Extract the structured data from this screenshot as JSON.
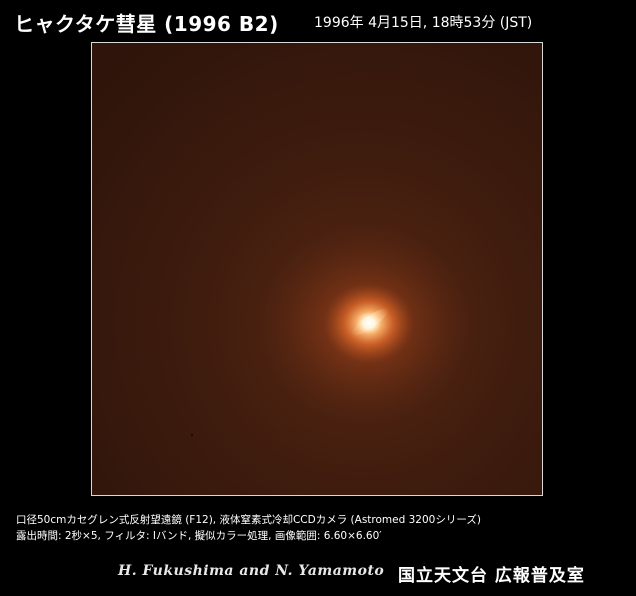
{
  "header": {
    "title": "ヒャクタケ彗星 (1996 B2)",
    "datetime": "1996年  4月15日, 18時53分 (JST)"
  },
  "photo": {
    "subject": "comet-image",
    "colors": {
      "background": "#3a1a0d",
      "coma_outer": "#8a3a18",
      "coma_mid": "#e06a2a",
      "nucleus": "#fff6e0"
    }
  },
  "caption": {
    "line1": "口径50cmカセグレン式反射望遠鏡 (F12), 液体窒素式冷却CCDカメラ (Astromed 3200シリーズ)",
    "line2": "露出時間: 2秒×5, フィルタ: Iバンド, 擬似カラー処理, 画像範囲: 6.60×6.60′"
  },
  "footer": {
    "credits": "H. Fukushima and N. Yamamoto",
    "institution": "国立天文台 広報普及室"
  }
}
